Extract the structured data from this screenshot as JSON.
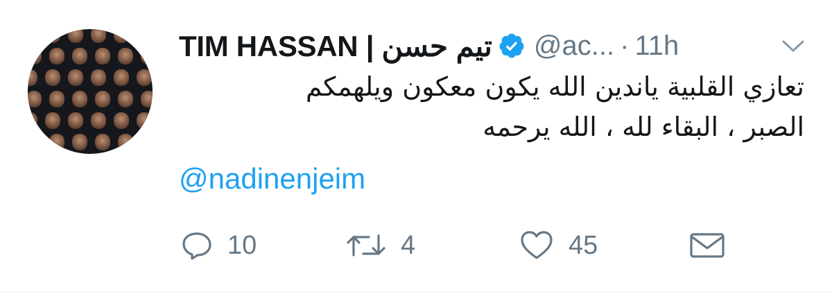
{
  "tweet": {
    "author_name": "TIM HASSAN | تيم حسن",
    "handle": "@ac...",
    "separator": "·",
    "time": "11h",
    "text_lines": [
      "تعازي القلبية ياندين  الله يكون معكون ويلهمكم",
      "الصبر ، البقاء لله ، الله يرحمه"
    ],
    "mention": "@nadinenjeim",
    "actions": {
      "reply_count": "10",
      "retweet_count": "4",
      "like_count": "45"
    },
    "icons": {
      "reply": "reply-icon",
      "retweet": "retweet-icon",
      "like": "heart-icon",
      "dm": "envelope-icon",
      "more": "chevron-down-icon",
      "verified": "verified-badge-icon"
    },
    "colors": {
      "text": "#14171a",
      "secondary": "#657786",
      "link": "#1da1f2",
      "verified": "#1da1f2"
    }
  }
}
